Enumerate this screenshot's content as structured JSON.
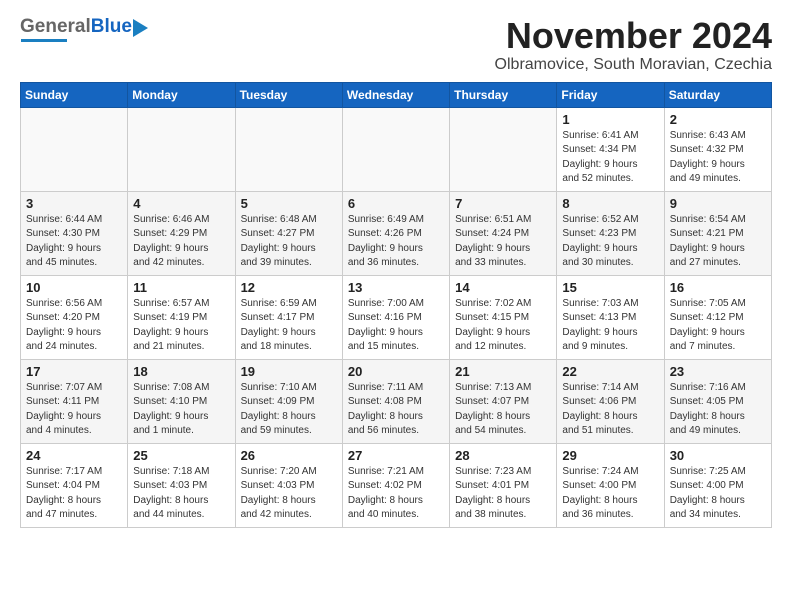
{
  "header": {
    "logo_general": "General",
    "logo_blue": "Blue",
    "month_title": "November 2024",
    "location": "Olbramovice, South Moravian, Czechia"
  },
  "days_of_week": [
    "Sunday",
    "Monday",
    "Tuesday",
    "Wednesday",
    "Thursday",
    "Friday",
    "Saturday"
  ],
  "weeks": [
    [
      {
        "num": "",
        "info": ""
      },
      {
        "num": "",
        "info": ""
      },
      {
        "num": "",
        "info": ""
      },
      {
        "num": "",
        "info": ""
      },
      {
        "num": "",
        "info": ""
      },
      {
        "num": "1",
        "info": "Sunrise: 6:41 AM\nSunset: 4:34 PM\nDaylight: 9 hours\nand 52 minutes."
      },
      {
        "num": "2",
        "info": "Sunrise: 6:43 AM\nSunset: 4:32 PM\nDaylight: 9 hours\nand 49 minutes."
      }
    ],
    [
      {
        "num": "3",
        "info": "Sunrise: 6:44 AM\nSunset: 4:30 PM\nDaylight: 9 hours\nand 45 minutes."
      },
      {
        "num": "4",
        "info": "Sunrise: 6:46 AM\nSunset: 4:29 PM\nDaylight: 9 hours\nand 42 minutes."
      },
      {
        "num": "5",
        "info": "Sunrise: 6:48 AM\nSunset: 4:27 PM\nDaylight: 9 hours\nand 39 minutes."
      },
      {
        "num": "6",
        "info": "Sunrise: 6:49 AM\nSunset: 4:26 PM\nDaylight: 9 hours\nand 36 minutes."
      },
      {
        "num": "7",
        "info": "Sunrise: 6:51 AM\nSunset: 4:24 PM\nDaylight: 9 hours\nand 33 minutes."
      },
      {
        "num": "8",
        "info": "Sunrise: 6:52 AM\nSunset: 4:23 PM\nDaylight: 9 hours\nand 30 minutes."
      },
      {
        "num": "9",
        "info": "Sunrise: 6:54 AM\nSunset: 4:21 PM\nDaylight: 9 hours\nand 27 minutes."
      }
    ],
    [
      {
        "num": "10",
        "info": "Sunrise: 6:56 AM\nSunset: 4:20 PM\nDaylight: 9 hours\nand 24 minutes."
      },
      {
        "num": "11",
        "info": "Sunrise: 6:57 AM\nSunset: 4:19 PM\nDaylight: 9 hours\nand 21 minutes."
      },
      {
        "num": "12",
        "info": "Sunrise: 6:59 AM\nSunset: 4:17 PM\nDaylight: 9 hours\nand 18 minutes."
      },
      {
        "num": "13",
        "info": "Sunrise: 7:00 AM\nSunset: 4:16 PM\nDaylight: 9 hours\nand 15 minutes."
      },
      {
        "num": "14",
        "info": "Sunrise: 7:02 AM\nSunset: 4:15 PM\nDaylight: 9 hours\nand 12 minutes."
      },
      {
        "num": "15",
        "info": "Sunrise: 7:03 AM\nSunset: 4:13 PM\nDaylight: 9 hours\nand 9 minutes."
      },
      {
        "num": "16",
        "info": "Sunrise: 7:05 AM\nSunset: 4:12 PM\nDaylight: 9 hours\nand 7 minutes."
      }
    ],
    [
      {
        "num": "17",
        "info": "Sunrise: 7:07 AM\nSunset: 4:11 PM\nDaylight: 9 hours\nand 4 minutes."
      },
      {
        "num": "18",
        "info": "Sunrise: 7:08 AM\nSunset: 4:10 PM\nDaylight: 9 hours\nand 1 minute."
      },
      {
        "num": "19",
        "info": "Sunrise: 7:10 AM\nSunset: 4:09 PM\nDaylight: 8 hours\nand 59 minutes."
      },
      {
        "num": "20",
        "info": "Sunrise: 7:11 AM\nSunset: 4:08 PM\nDaylight: 8 hours\nand 56 minutes."
      },
      {
        "num": "21",
        "info": "Sunrise: 7:13 AM\nSunset: 4:07 PM\nDaylight: 8 hours\nand 54 minutes."
      },
      {
        "num": "22",
        "info": "Sunrise: 7:14 AM\nSunset: 4:06 PM\nDaylight: 8 hours\nand 51 minutes."
      },
      {
        "num": "23",
        "info": "Sunrise: 7:16 AM\nSunset: 4:05 PM\nDaylight: 8 hours\nand 49 minutes."
      }
    ],
    [
      {
        "num": "24",
        "info": "Sunrise: 7:17 AM\nSunset: 4:04 PM\nDaylight: 8 hours\nand 47 minutes."
      },
      {
        "num": "25",
        "info": "Sunrise: 7:18 AM\nSunset: 4:03 PM\nDaylight: 8 hours\nand 44 minutes."
      },
      {
        "num": "26",
        "info": "Sunrise: 7:20 AM\nSunset: 4:03 PM\nDaylight: 8 hours\nand 42 minutes."
      },
      {
        "num": "27",
        "info": "Sunrise: 7:21 AM\nSunset: 4:02 PM\nDaylight: 8 hours\nand 40 minutes."
      },
      {
        "num": "28",
        "info": "Sunrise: 7:23 AM\nSunset: 4:01 PM\nDaylight: 8 hours\nand 38 minutes."
      },
      {
        "num": "29",
        "info": "Sunrise: 7:24 AM\nSunset: 4:00 PM\nDaylight: 8 hours\nand 36 minutes."
      },
      {
        "num": "30",
        "info": "Sunrise: 7:25 AM\nSunset: 4:00 PM\nDaylight: 8 hours\nand 34 minutes."
      }
    ]
  ]
}
